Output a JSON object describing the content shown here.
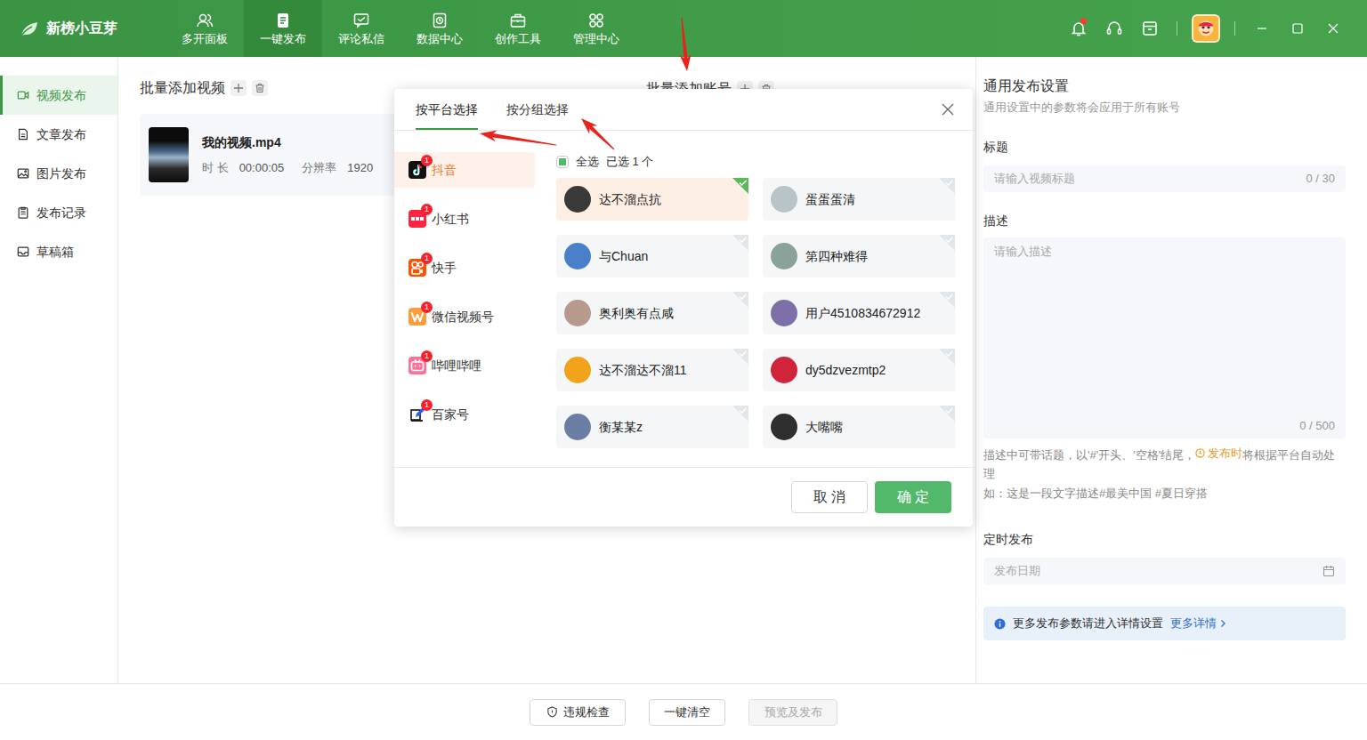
{
  "app": {
    "logo": "新榜小豆芽",
    "notifications_unread": true
  },
  "nav": [
    {
      "label": "多开面板",
      "selected": false
    },
    {
      "label": "一键发布",
      "selected": true
    },
    {
      "label": "评论私信",
      "selected": false
    },
    {
      "label": "数据中心",
      "selected": false
    },
    {
      "label": "创作工具",
      "selected": false
    },
    {
      "label": "管理中心",
      "selected": false
    }
  ],
  "sidebar": [
    {
      "label": "视频发布",
      "selected": true
    },
    {
      "label": "文章发布",
      "selected": false
    },
    {
      "label": "图片发布",
      "selected": false
    },
    {
      "label": "发布记录",
      "selected": false
    },
    {
      "label": "草稿箱",
      "selected": false
    }
  ],
  "video_section": {
    "title": "批量添加视频",
    "videos": [
      {
        "name": "我的视频.mp4",
        "duration_label": "时 长",
        "duration": "00:00:05",
        "resolution_label": "分辨率",
        "resolution": "1920"
      }
    ]
  },
  "account_section": {
    "title": "批量添加账号"
  },
  "settings": {
    "title": "通用发布设置",
    "subtitle": "通用设置中的参数将会应用于所有账号",
    "title_field": {
      "label": "标题",
      "placeholder": "请输入视频标题",
      "counter": "0 / 30"
    },
    "desc_field": {
      "label": "描述",
      "placeholder": "请输入描述",
      "counter": "0 / 500"
    },
    "hint": {
      "before": "描述中可带话题，以'#'开头、'空格'结尾，",
      "highlight": "发布时",
      "after": "将根据平台自动处理",
      "example": "如：这是一段文字描述#最美中国 #夏日穿搭"
    },
    "schedule_field": {
      "label": "定时发布",
      "placeholder": "发布日期"
    },
    "info": {
      "text": "更多发布参数请进入详情设置",
      "link": "更多详情"
    }
  },
  "bottom_buttons": [
    {
      "label": "违规检查",
      "disabled": false
    },
    {
      "label": "一键清空",
      "disabled": false
    },
    {
      "label": "预览及发布",
      "disabled": true
    }
  ],
  "dialog": {
    "tabs": [
      {
        "label": "按平台选择",
        "selected": true
      },
      {
        "label": "按分组选择",
        "selected": false
      }
    ],
    "platforms": [
      {
        "name": "抖音",
        "badge": "1",
        "selected": true
      },
      {
        "name": "小红书",
        "badge": "1",
        "selected": false
      },
      {
        "name": "快手",
        "badge": "1",
        "selected": false
      },
      {
        "name": "微信视频号",
        "badge": "1",
        "selected": false
      },
      {
        "name": "哔哩哔哩",
        "badge": "1",
        "selected": false
      },
      {
        "name": "百家号",
        "badge": "1",
        "selected": false
      }
    ],
    "select_all": {
      "label": "全选",
      "checked": false,
      "indeterminate": true
    },
    "selected_count": "已选 1 个",
    "accounts": [
      {
        "name": "达不溜点抗",
        "checked": true
      },
      {
        "name": "蛋蛋蛋清",
        "checked": false
      },
      {
        "name": "与Chuan",
        "checked": false
      },
      {
        "name": "第四种难得",
        "checked": false
      },
      {
        "name": "奥利奥有点咸",
        "checked": false
      },
      {
        "name": "用户4510834672912",
        "checked": false
      },
      {
        "name": "达不溜达不溜11",
        "checked": false
      },
      {
        "name": "dy5dzvezmtp2",
        "checked": false
      },
      {
        "name": "衡某某z",
        "checked": false
      },
      {
        "name": "大嘴嘴",
        "checked": false
      }
    ],
    "buttons": [
      {
        "label": "取 消",
        "primary": false
      },
      {
        "label": "确 定",
        "primary": true
      }
    ]
  }
}
